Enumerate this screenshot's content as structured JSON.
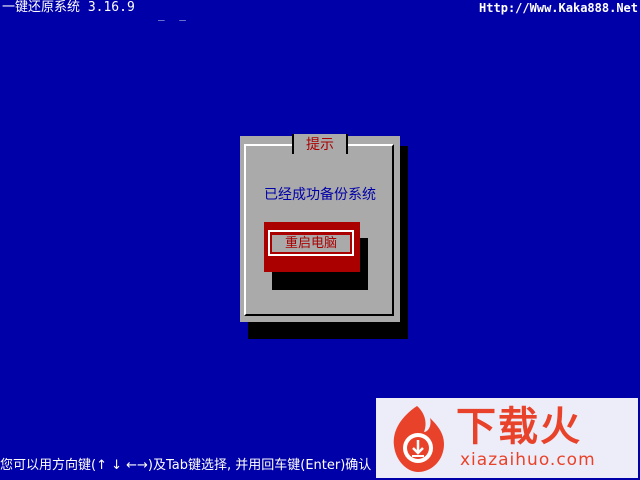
{
  "header": {
    "app_title": "一键还原系统 3.16.9",
    "cursor_marks": "_ _",
    "site_url": "Http://Www.Kaka888.Net"
  },
  "dialog": {
    "title": "提示",
    "message": "已经成功备份系统",
    "button_label": "重启电脑"
  },
  "status_line": "您可以用方向键(↑ ↓ ←→)及Tab键选择, 并用回车键(Enter)确认",
  "watermark": {
    "name": "下载火",
    "domain": "xiazaihuo.com"
  },
  "colors": {
    "background": "#0000A8",
    "dialog": "#AAAAAA",
    "accent_red": "#AA0000",
    "watermark_red": "#E8432A"
  }
}
